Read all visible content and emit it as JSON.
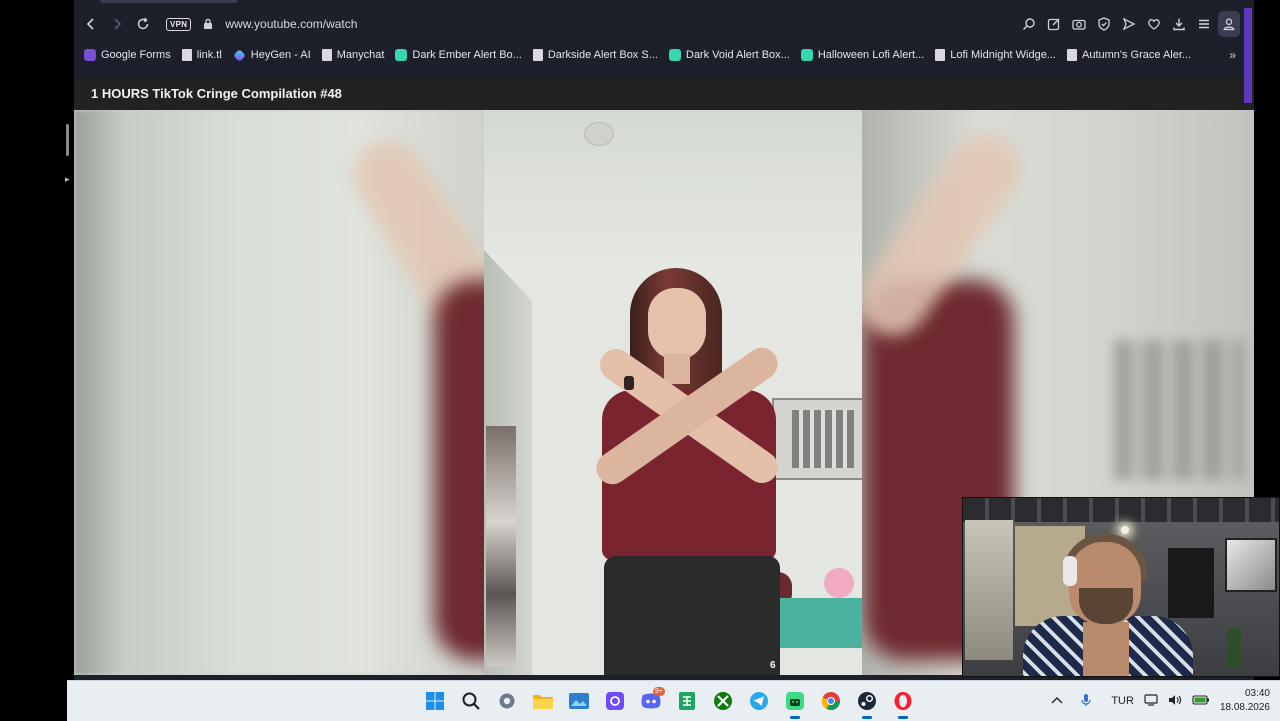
{
  "browser": {
    "url": "www.youtube.com/watch",
    "vpn_label": "VPN",
    "toolbar_icons": [
      "search-icon",
      "pencil-icon",
      "camera-icon",
      "shield-icon",
      "send-icon",
      "heart-icon",
      "download-icon",
      "menu-icon",
      "profile-icon"
    ]
  },
  "bookmarks": {
    "items": [
      {
        "label": "Google Forms",
        "icon": "forms-icon"
      },
      {
        "label": "link.tl",
        "icon": "page-icon"
      },
      {
        "label": "HeyGen - AI",
        "icon": "heygen-icon"
      },
      {
        "label": "Manychat",
        "icon": "page-icon"
      },
      {
        "label": "Dark Ember Alert Bo...",
        "icon": "alert-icon"
      },
      {
        "label": "Darkside Alert Box S...",
        "icon": "page-icon"
      },
      {
        "label": "Dark Void Alert Box...",
        "icon": "alert-icon"
      },
      {
        "label": "Halloween Lofi Alert...",
        "icon": "alert-icon"
      },
      {
        "label": "Lofi Midnight Widge...",
        "icon": "page-icon"
      },
      {
        "label": "Autumn's Grace Aler...",
        "icon": "page-icon"
      }
    ],
    "more": "»"
  },
  "video": {
    "title": "1 HOURS TikTok Cringe Compilation #48",
    "corner_number": "6"
  },
  "taskbar": {
    "apps": [
      "windows-start-icon",
      "search-icon",
      "settings-icon",
      "file-explorer-icon",
      "photos-icon",
      "proton-pass-icon",
      "discord-icon",
      "spreadsheet-icon",
      "xbox-icon",
      "telegram-icon",
      "android-app-icon",
      "chrome-icon",
      "steam-icon",
      "opera-icon"
    ],
    "discord_badge": "9+",
    "language": "TUR",
    "time": "03:40",
    "date": "18.08.2026"
  },
  "colors": {
    "browser_bg": "#1d1f2b",
    "accent": "#6a3dd8",
    "taskbar_bg": "#e9eef3"
  }
}
